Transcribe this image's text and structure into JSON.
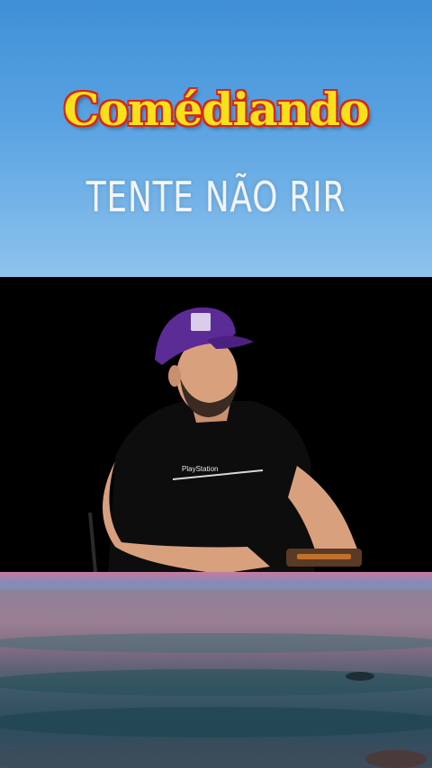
{
  "header": {
    "brand": "Comédiando",
    "subtitle": "TENTE NÃO RIR"
  },
  "video": {
    "shirt_text": "PlayStation"
  },
  "colors": {
    "brand_fill": "#f7e11b",
    "brand_outline": "#d8251c",
    "sky": "#5aa3e2",
    "cap": "#5b2b96"
  }
}
